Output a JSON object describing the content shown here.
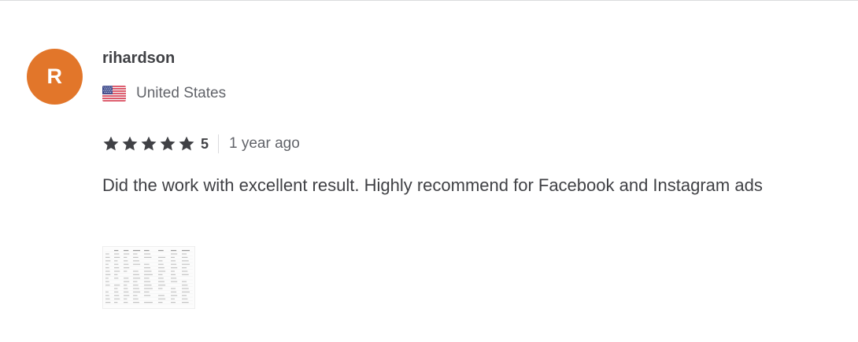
{
  "review": {
    "avatar_initial": "R",
    "avatar_color": "#e2762a",
    "username": "rihardson",
    "country": "United States",
    "country_flag_icon": "us-flag-icon",
    "rating": 5,
    "rating_label": "5",
    "star_icon": "star-icon",
    "star_color": "#404145",
    "time_ago": "1 year ago",
    "text": "Did the work with excellent result. Highly recommend for Facebook and Instagram ads",
    "attachment": {
      "kind": "spreadsheet-thumbnail"
    }
  }
}
